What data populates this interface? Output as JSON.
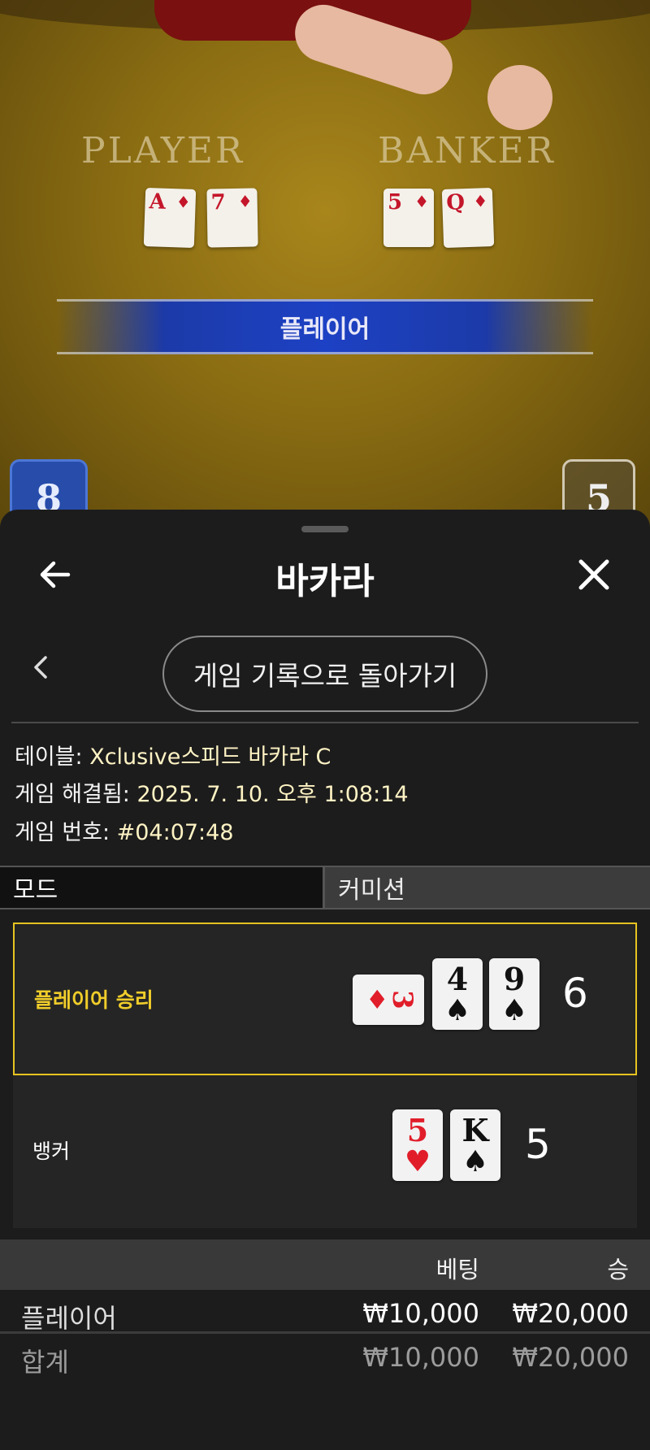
{
  "video": {
    "player_label": "PLAYER",
    "banker_label": "BANKER",
    "player_cards": [
      {
        "rank": "A",
        "suit": "♦"
      },
      {
        "rank": "7",
        "suit": "♦"
      }
    ],
    "banker_cards": [
      {
        "rank": "5",
        "suit": "♦"
      },
      {
        "rank": "Q",
        "suit": "♦"
      }
    ],
    "result_banner": "플레이어",
    "player_score": "8",
    "banker_score": "5"
  },
  "sheet": {
    "title": "바카라",
    "back_icon": "arrow-left-icon",
    "close_icon": "close-icon",
    "return_button": "게임 기록으로 돌아가기",
    "info": {
      "table_label": "테이블: ",
      "table_value": "Xclusive스피드 바카라 C",
      "resolved_label": "게임 해결됨: ",
      "resolved_value": "2025. 7. 10. 오후 1:08:14",
      "game_no_label": "게임 번호: ",
      "game_no_value": "#04:07:48"
    },
    "modes": {
      "mode_label": "모드",
      "mode_value": "커미션"
    },
    "results": {
      "player": {
        "label": "플레이어 승리",
        "cards": [
          {
            "rank": "3",
            "suit": "♦",
            "color": "red",
            "sideways": true
          },
          {
            "rank": "4",
            "suit": "♠",
            "color": "black"
          },
          {
            "rank": "9",
            "suit": "♠",
            "color": "black"
          }
        ],
        "total": "6"
      },
      "banker": {
        "label": "뱅커",
        "cards": [
          {
            "rank": "5",
            "suit": "♥",
            "color": "red"
          },
          {
            "rank": "K",
            "suit": "♠",
            "color": "black"
          }
        ],
        "total": "5"
      }
    },
    "bets": {
      "col_bet": "베팅",
      "col_win": "승",
      "rows": [
        {
          "name": "플레이어",
          "bet": "₩10,000",
          "win": "₩20,000"
        }
      ],
      "total": {
        "name": "합계",
        "bet": "₩10,000",
        "win": "₩20,000"
      }
    }
  },
  "colors": {
    "win_highlight": "#e6c320",
    "player_blue": "#1d41c4"
  }
}
